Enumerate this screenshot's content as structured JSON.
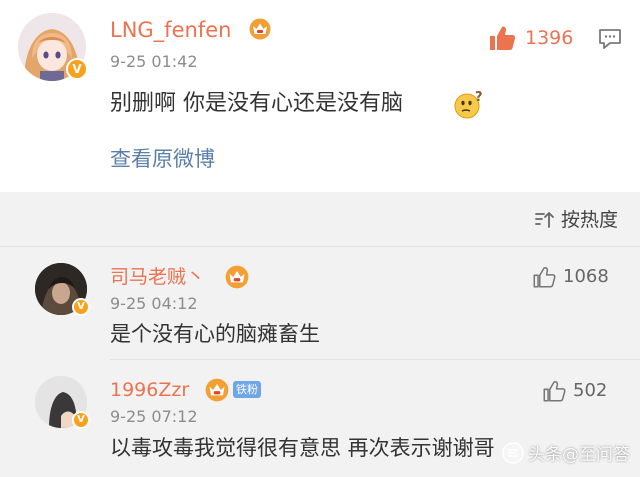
{
  "main_comment": {
    "username": "LNG_fenfen",
    "time": "9-25 01:42",
    "text": "别删啊 你是没有心还是没有脑",
    "like_count": "1396",
    "view_original": "查看原微博",
    "emoji": "thinking-face-icon",
    "crown_icon": "vip-crown-icon",
    "verified_badge": "V"
  },
  "sort": {
    "label": "按热度",
    "icon": "sort-icon"
  },
  "comments": [
    {
      "username": "司马老贼丶",
      "time": "9-25 04:12",
      "text": "是个没有心的脑瘫畜生",
      "like_count": "1068",
      "verified_badge": "V"
    },
    {
      "username": "1996Zzr",
      "fan_badge": "铁粉",
      "time": "9-25 07:12",
      "text": "以毒攻毒我觉得很有意思 再次表示谢谢哥",
      "like_count": "502",
      "verified_badge": "V"
    }
  ],
  "watermark": {
    "text": "头条@至问答"
  },
  "colors": {
    "username": "#eb7350",
    "like_active": "#eb7350",
    "link": "#5b7fa8",
    "time": "#8c8c8c",
    "section_bg": "#f2f2f2"
  }
}
